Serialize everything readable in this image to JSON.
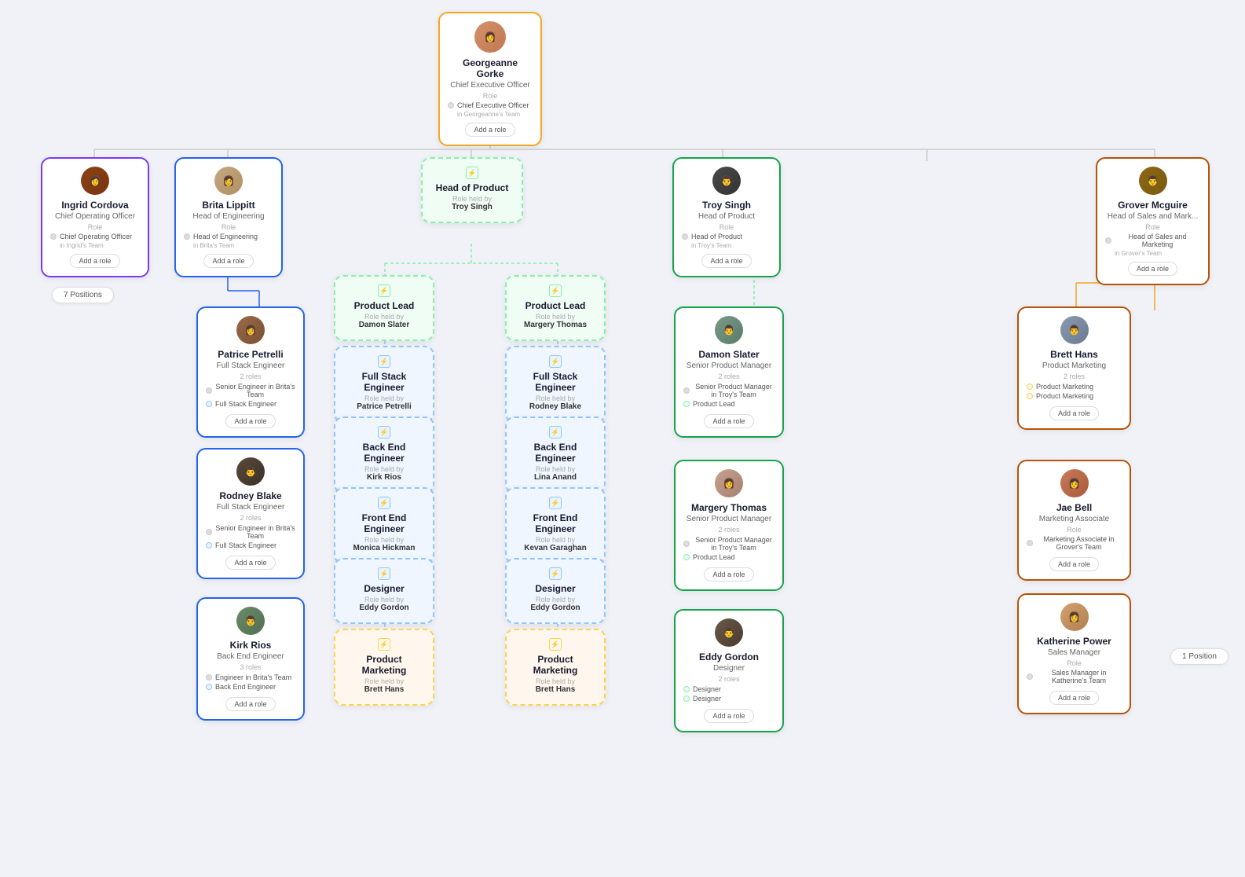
{
  "ceo": {
    "name": "Georgeanne Gorke",
    "title": "Chief Executive Officer",
    "role_label": "Role",
    "role_item": "Chief Executive Officer",
    "role_team": "in Georgeanne's Team",
    "add_role": "Add a role",
    "avatar_color": "#d4916b",
    "avatar_letter": "G"
  },
  "nodes": [
    {
      "id": "ingrid",
      "name": "Ingrid Cordova",
      "title": "Chief Operating Officer",
      "role_label": "Role",
      "role_item": "Chief Operating Officer",
      "role_team": "in Ingrid's Team",
      "add_role": "Add a role",
      "border": "purple",
      "avatar_color": "#8b4513",
      "avatar_letter": "I"
    },
    {
      "id": "brita",
      "name": "Brita Lippitt",
      "title": "Head of Engineering",
      "role_label": "Role",
      "role_item": "Head of Engineering",
      "role_team": "in Brita's Team",
      "add_role": "Add a role",
      "border": "blue",
      "avatar_color": "#c4a882",
      "avatar_letter": "B"
    },
    {
      "id": "head_product_role",
      "title": "Head of Product",
      "role_held_by_label": "Role held by",
      "role_held_by": "Troy Singh",
      "border": "dashed-green"
    },
    {
      "id": "troy",
      "name": "Troy Singh",
      "title": "Head of Product",
      "role_label": "Role",
      "role_item": "Head of Product",
      "role_team": "in Troy's Team",
      "add_role": "Add a role",
      "border": "green",
      "avatar_color": "#4a4a4a",
      "avatar_letter": "T"
    },
    {
      "id": "grover",
      "name": "Grover Mcguire",
      "title": "Head of Sales and Mark...",
      "role_label": "Role",
      "role_item": "Head of Sales and Marketing",
      "role_team": "in Grover's Team",
      "add_role": "Add a role",
      "border": "brown",
      "avatar_color": "#8b6914",
      "avatar_letter": "G"
    },
    {
      "id": "patrice",
      "name": "Patrice Petrelli",
      "title": "Full Stack Engineer",
      "roles_count": "2 roles",
      "role1": "Senior Engineer in Brita's Team",
      "role2": "Full Stack Engineer",
      "add_role": "Add a role",
      "border": "blue",
      "avatar_color": "#9b6a4a",
      "avatar_letter": "P"
    },
    {
      "id": "rodney",
      "name": "Rodney Blake",
      "title": "Full Stack Engineer",
      "roles_count": "2 roles",
      "role1": "Senior Engineer in Brita's Team",
      "role2": "Full Stack Engineer",
      "add_role": "Add a role",
      "border": "blue",
      "avatar_color": "#5a4a3a",
      "avatar_letter": "R"
    },
    {
      "id": "kirk",
      "name": "Kirk Rios",
      "title": "Back End Engineer",
      "roles_count": "3 roles",
      "role1": "Engineer in Brita's Team",
      "role2": "Back End Engineer",
      "add_role": "Add a role",
      "border": "blue",
      "avatar_color": "#6a8a6a",
      "avatar_letter": "K"
    },
    {
      "id": "product_lead_damon_role",
      "title": "Product Lead",
      "role_held_by_label": "Role held by",
      "role_held_by": "Damon Slater",
      "border": "dashed-green"
    },
    {
      "id": "product_lead_margery_role",
      "title": "Product Lead",
      "role_held_by_label": "Role held by",
      "role_held_by": "Margery Thomas",
      "border": "dashed-green"
    },
    {
      "id": "full_stack_patrice_role",
      "title": "Full Stack Engineer",
      "role_held_by_label": "Role held by",
      "role_held_by": "Patrice Petrelli",
      "border": "dashed-blue"
    },
    {
      "id": "full_stack_rodney_role",
      "title": "Full Stack Engineer",
      "role_held_by_label": "Role held by",
      "role_held_by": "Rodney Blake",
      "border": "dashed-blue"
    },
    {
      "id": "backend_kirk_role",
      "title": "Back End Engineer",
      "role_held_by_label": "Role held by",
      "role_held_by": "Kirk Rios",
      "border": "dashed-blue"
    },
    {
      "id": "backend_lina_role",
      "title": "Back End Engineer",
      "role_held_by_label": "Role held by",
      "role_held_by": "Lina Anand",
      "border": "dashed-blue"
    },
    {
      "id": "frontend_monica_role",
      "title": "Front End Engineer",
      "role_held_by_label": "Role held by",
      "role_held_by": "Monica Hickman",
      "border": "dashed-blue"
    },
    {
      "id": "frontend_kevan_role",
      "title": "Front End Engineer",
      "role_held_by_label": "Role held by",
      "role_held_by": "Kevan Garaghan",
      "border": "dashed-blue"
    },
    {
      "id": "designer_eddy1_role",
      "title": "Designer",
      "role_held_by_label": "Role held by",
      "role_held_by": "Eddy Gordon",
      "border": "dashed-blue"
    },
    {
      "id": "designer_eddy2_role",
      "title": "Designer",
      "role_held_by_label": "Role held by",
      "role_held_by": "Eddy Gordon",
      "border": "dashed-blue"
    },
    {
      "id": "product_mktg1_role",
      "title": "Product Marketing",
      "role_held_by_label": "Role held by",
      "role_held_by": "Brett Hans",
      "border": "dashed-orange"
    },
    {
      "id": "product_mktg2_role",
      "title": "Product Marketing",
      "role_held_by_label": "Role held by",
      "role_held_by": "Brett Hans",
      "border": "dashed-orange"
    },
    {
      "id": "damon",
      "name": "Damon Slater",
      "title": "Senior Product Manager",
      "roles_count": "2 roles",
      "role1": "Senior Product Manager in Troy's Team",
      "role2": "Product Lead",
      "add_role": "Add a role",
      "border": "green",
      "avatar_color": "#7a9a8a",
      "avatar_letter": "D"
    },
    {
      "id": "margery",
      "name": "Margery Thomas",
      "title": "Senior Product Manager",
      "roles_count": "2 roles",
      "role1": "Senior Product Manager in Troy's Team",
      "role2": "Product Lead",
      "add_role": "Add a role",
      "border": "green",
      "avatar_color": "#c8a090",
      "avatar_letter": "M"
    },
    {
      "id": "eddy",
      "name": "Eddy Gordon",
      "title": "Designer",
      "roles_count": "2 roles",
      "role1": "Designer",
      "role2": "Designer",
      "add_role": "Add a role",
      "border": "green",
      "avatar_color": "#6a5a4a",
      "avatar_letter": "E"
    },
    {
      "id": "brett",
      "name": "Brett Hans",
      "title": "Product Marketing",
      "roles_count": "2 roles",
      "role1": "Product Marketing",
      "role2": "Product Marketing",
      "add_role": "Add a role",
      "border": "brown",
      "avatar_color": "#8a9ab0",
      "avatar_letter": "B"
    },
    {
      "id": "jae",
      "name": "Jae Bell",
      "title": "Marketing Associate",
      "role_label": "Role",
      "role_item": "Marketing Associate in Grover's Team",
      "add_role": "Add a role",
      "border": "brown",
      "avatar_color": "#c87a5a",
      "avatar_letter": "J"
    },
    {
      "id": "katherine",
      "name": "Katherine Power",
      "title": "Sales Manager",
      "role_label": "Role",
      "role_item": "Sales Manager in Katherine's Team",
      "add_role": "Add a role",
      "border": "brown",
      "avatar_color": "#d4a070",
      "avatar_letter": "K"
    }
  ],
  "badges": [
    {
      "id": "ingrid_positions",
      "text": "7 Positions"
    },
    {
      "id": "katherine_positions",
      "text": "1 Position"
    }
  ]
}
